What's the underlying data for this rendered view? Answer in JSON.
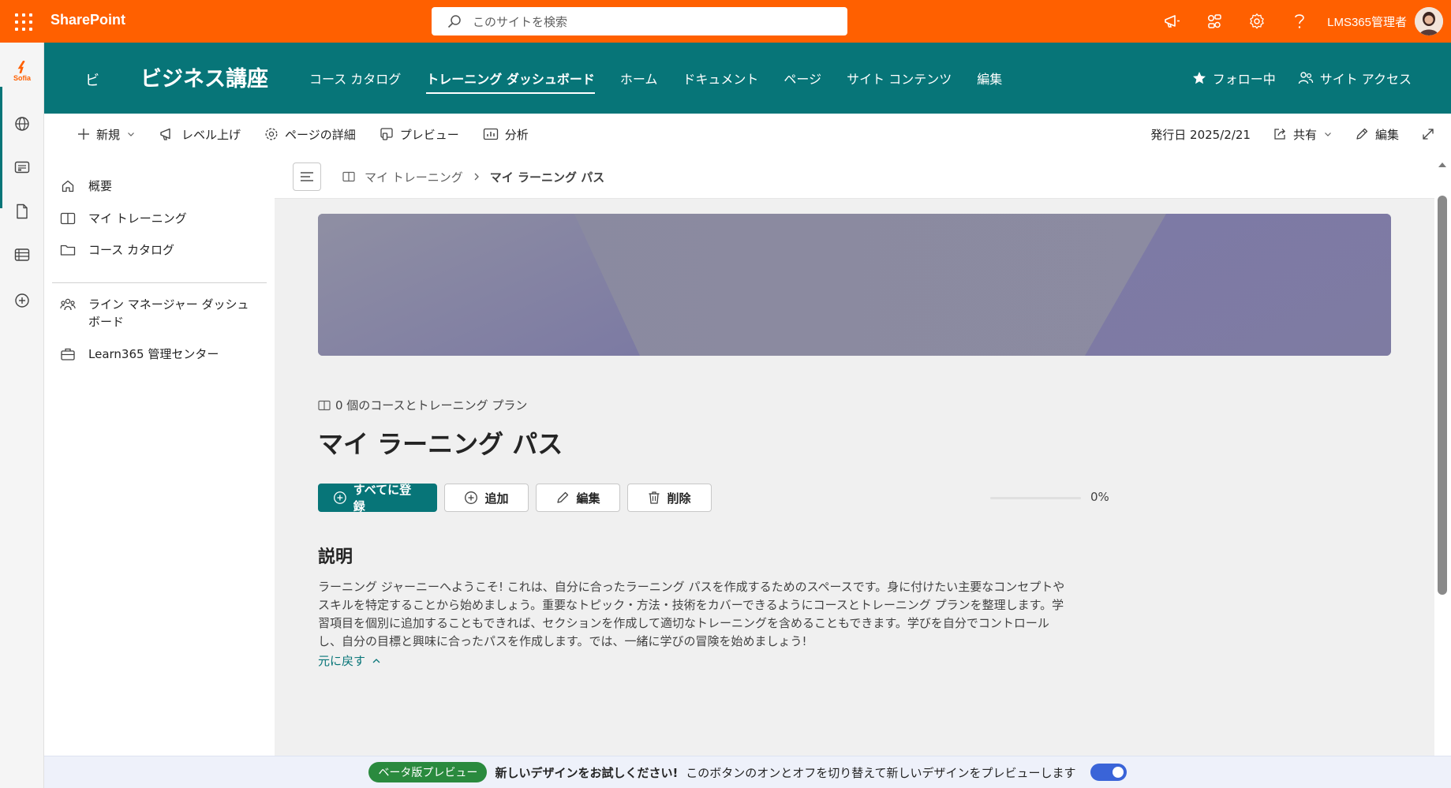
{
  "suite": {
    "brand": "SharePoint",
    "search_placeholder": "このサイトを検索",
    "user_name": "LMS365管理者"
  },
  "rail": {
    "sofia_label": "Sofia"
  },
  "site": {
    "logo_char": "ビ",
    "title": "ビジネス講座",
    "nav": [
      {
        "label": "コース カタログ"
      },
      {
        "label": "トレーニング ダッシュボード"
      },
      {
        "label": "ホーム"
      },
      {
        "label": "ドキュメント"
      },
      {
        "label": "ページ"
      },
      {
        "label": "サイト コンテンツ"
      },
      {
        "label": "編集"
      }
    ],
    "follow_label": "フォロー中",
    "access_label": "サイト アクセス"
  },
  "commandbar": {
    "new_label": "新規",
    "promote_label": "レベル上げ",
    "details_label": "ページの詳細",
    "preview_label": "プレビュー",
    "analytics_label": "分析",
    "published_label": "発行日 2025/2/21",
    "share_label": "共有",
    "edit_label": "編集"
  },
  "leftnav": {
    "items": [
      {
        "label": "概要"
      },
      {
        "label": "マイ トレーニング"
      },
      {
        "label": "コース カタログ"
      },
      {
        "label": "ライン マネージャー ダッシュボード"
      },
      {
        "label": "Learn365 管理センター"
      }
    ]
  },
  "breadcrumb": {
    "parent": "マイ トレーニング",
    "current": "マイ ラーニング パス"
  },
  "learning_path": {
    "meta": "0 個のコースとトレーニング プラン",
    "title": "マイ ラーニング パス",
    "enroll_all_label": "すべてに登録",
    "add_label": "追加",
    "edit_label": "編集",
    "delete_label": "削除",
    "progress_value": 0,
    "progress_text": "0%",
    "description_heading": "説明",
    "description_lines": [
      "ラーニング ジャーニーへようこそ! これは、自分に合ったラーニング パスを作成するためのスペースです。身に付けたい主要なコンセプトや",
      "スキルを特定することから始めましょう。重要なトピック・方法・技術をカバーできるようにコースとトレーニング プランを整理します。学",
      "習項目を個別に追加することもできれば、セクションを作成して適切なトレーニングを含めることもできます。学びを自分でコントロール",
      "し、自分の目標と興味に合ったパスを作成します。では、一緒に学びの冒険を始めましょう!"
    ],
    "back_label": "元に戻す"
  },
  "betabar": {
    "pill": "ベータ版プレビュー",
    "strong": "新しいデザインをお試しください!",
    "text": "このボタンのオンとオフを切り替えて新しいデザインをプレビューします",
    "toggle_on": true
  },
  "colors": {
    "suite": "#ff6000",
    "site_header": "#077578",
    "primary": "#077578",
    "banner_base": "#8a8aa0",
    "banner_accent": "#7a76a6",
    "beta_pill": "#2a8a3e",
    "toggle": "#3a64d8"
  }
}
